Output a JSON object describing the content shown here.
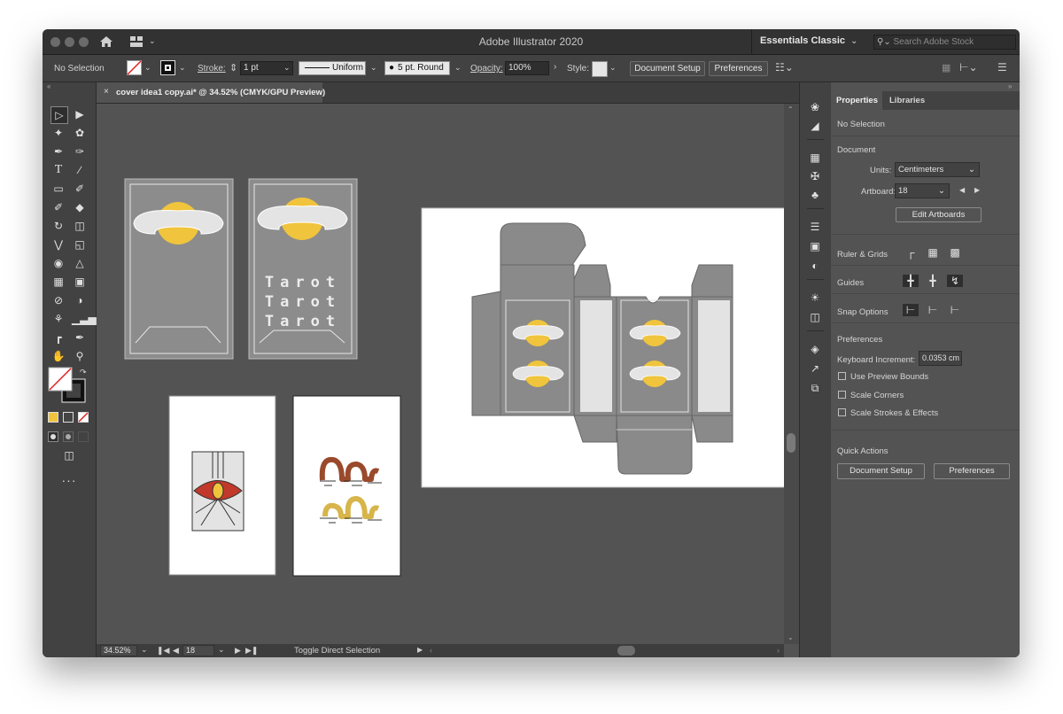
{
  "window": {
    "title": "Adobe Illustrator 2020"
  },
  "titlebar": {
    "workspace": "Essentials Classic",
    "search_placeholder": "Search Adobe Stock"
  },
  "control_bar": {
    "selection": "No Selection",
    "stroke_label": "Stroke:",
    "stroke_weight": "1 pt",
    "profile": "Uniform",
    "brush": "5 pt. Round",
    "opacity_label": "Opacity:",
    "opacity_value": "100%",
    "style_label": "Style:",
    "document_setup": "Document Setup",
    "preferences": "Preferences"
  },
  "document_tab": {
    "title": "cover idea1 copy.ai* @ 34.52% (CMYK/GPU Preview)"
  },
  "artboards": {
    "tarot_text": "Tarot",
    "accent_yellow": "#f0c43c",
    "card_grey": "#8c8c8c",
    "eye_red": "#c0392b",
    "serpent_brown": "#9a4a2c",
    "serpent_yellow": "#d7b54a"
  },
  "status_bar": {
    "zoom": "34.52%",
    "artboard_number": "18",
    "tool_hint": "Toggle Direct Selection"
  },
  "properties_panel": {
    "tabs": [
      "Properties",
      "Libraries"
    ],
    "selection": "No Selection",
    "document_heading": "Document",
    "units_label": "Units:",
    "units_value": "Centimeters",
    "artboard_label": "Artboard:",
    "artboard_value": "18",
    "edit_artboards": "Edit Artboards",
    "ruler_grids": "Ruler & Grids",
    "guides": "Guides",
    "snap_options": "Snap Options",
    "preferences_heading": "Preferences",
    "keyboard_increment_label": "Keyboard Increment:",
    "keyboard_increment_value": "0.0353 cm",
    "use_preview_bounds": "Use Preview Bounds",
    "scale_corners": "Scale Corners",
    "scale_strokes": "Scale Strokes & Effects",
    "quick_actions": "Quick Actions",
    "document_setup": "Document Setup",
    "preferences": "Preferences"
  }
}
